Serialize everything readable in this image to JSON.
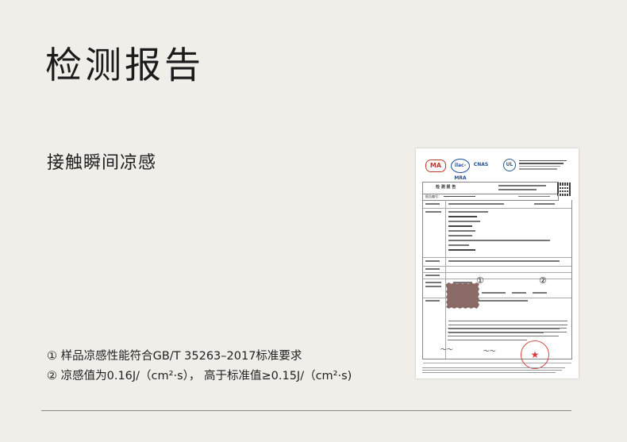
{
  "header": {
    "title": "检测报告"
  },
  "section": {
    "title": "接触瞬间凉感"
  },
  "notes": [
    "① 样品凉感性能符合GB/T 35263–2017标准要求",
    "② 凉感值为0.16J/（cm²·s）， 高于标准值≥0.15J/（cm²·s)"
  ],
  "certificate": {
    "marker_1": "①",
    "marker_2": "②",
    "header_label": "检 测 报 告",
    "report_no_label": "报告编号：",
    "ma_logo_text": "MA",
    "cnas_logo_text": "ilac-MRA",
    "cnas2_logo_text": "CNAS",
    "ul_logo_text": "UL",
    "stamp_icon": "star-seal-icon"
  },
  "colors": {
    "background": "#f1eeea",
    "text": "#1b1b1b",
    "divider": "#8a8784",
    "stamp": "#d22828"
  }
}
